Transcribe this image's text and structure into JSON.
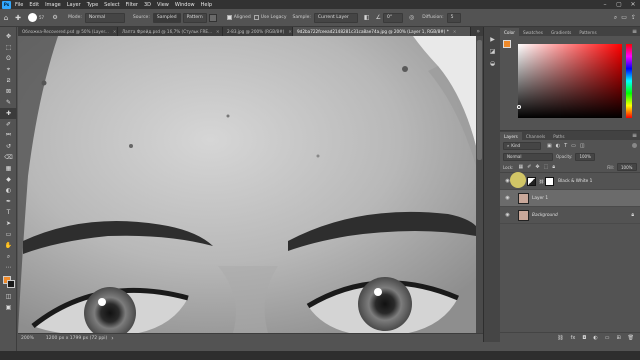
{
  "app": {
    "logo_text": "Ps"
  },
  "menu": [
    "File",
    "Edit",
    "Image",
    "Layer",
    "Type",
    "Select",
    "Filter",
    "3D",
    "View",
    "Window",
    "Help"
  ],
  "window_controls": [
    "–",
    "▢",
    "✕"
  ],
  "options_bar": {
    "brush_size": "57",
    "mode_label": "Mode:",
    "mode_value": "Normal",
    "source_label": "Source:",
    "source_sampled": "Sampled",
    "source_pattern": "Pattern",
    "aligned_label": "Aligned",
    "use_legacy_label": "Use Legacy",
    "sample_label": "Sample:",
    "sample_value": "Current Layer",
    "angle_value": "0°",
    "diffusion_label": "Diffusion:",
    "diffusion_value": "5"
  },
  "tabs": [
    {
      "label": "Обложка-Recovered.psd @ 50% (Layer..."
    },
    {
      "label": "Лапта Фрейд.psd @ 16,7% (Стульк FRE..."
    },
    {
      "label": "2-83.jpg @ 200% (RGB/8#)"
    },
    {
      "label": "9d2ba722fceead2148281c31ca8ae74a.jpg @ 200% (Layer 1, RGB/8#) *"
    }
  ],
  "status": {
    "zoom": "200%",
    "doc_info": "1200 px x 1799 px (72 ppi)"
  },
  "color_panel": {
    "tabs": [
      "Color",
      "Swatches",
      "Gradients",
      "Patterns"
    ],
    "fg_color": "#ef8a2a",
    "bg_color": "#1a1a1a"
  },
  "layers_panel": {
    "tabs": [
      "Layers",
      "Channels",
      "Paths"
    ],
    "filter_label": "Kind",
    "blend_mode": "Normal",
    "opacity_label": "Opacity:",
    "opacity_value": "100%",
    "lock_label": "Lock:",
    "fill_label": "Fill:",
    "fill_value": "100%",
    "layers": [
      {
        "name": "Black & White 1",
        "type": "adjustment"
      },
      {
        "name": "Layer 1",
        "type": "pixel",
        "selected": true
      },
      {
        "name": "Background",
        "type": "background",
        "locked": true
      }
    ]
  },
  "tools": [
    "move-icon",
    "marquee-icon",
    "lasso-icon",
    "quick-select-icon",
    "crop-icon",
    "frame-icon",
    "eyedropper-icon",
    "healing-icon",
    "brush-icon",
    "clone-stamp-icon",
    "history-brush-icon",
    "eraser-icon",
    "gradient-icon",
    "blur-icon",
    "dodge-icon",
    "pen-icon",
    "type-icon",
    "path-select-icon",
    "shape-icon",
    "hand-icon",
    "zoom-icon",
    "more-icon"
  ],
  "tool_glyphs": [
    "✥",
    "⬚",
    "ʘ",
    "⌖",
    "⧄",
    "⊠",
    "✎",
    "✚",
    "✐",
    "⎃",
    "↺",
    "⌫",
    "▦",
    "◆",
    "◐",
    "✒",
    "T",
    "➤",
    "▭",
    "✋",
    "⌕",
    "⋯"
  ],
  "accent_colors": {
    "app_blue": "#31a8ff",
    "highlight_yellow": "#e8d96a"
  }
}
